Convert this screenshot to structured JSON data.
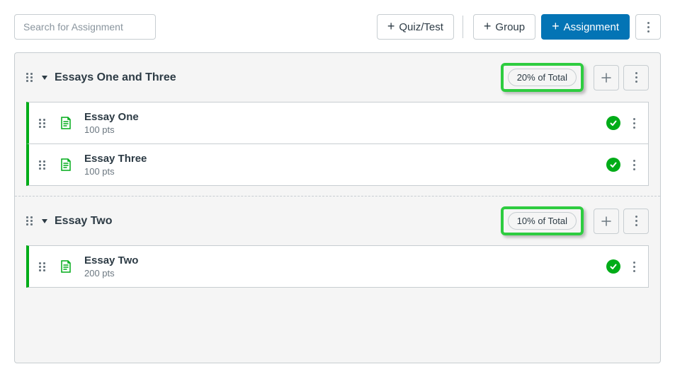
{
  "search": {
    "placeholder": "Search for Assignment"
  },
  "toolbar": {
    "quiz_label": "Quiz/Test",
    "group_label": "Group",
    "assignment_label": "Assignment"
  },
  "groups": [
    {
      "title": "Essays One and Three",
      "weight": "20% of Total",
      "items": [
        {
          "title": "Essay One",
          "pts": "100 pts"
        },
        {
          "title": "Essay Three",
          "pts": "100 pts"
        }
      ]
    },
    {
      "title": "Essay Two",
      "weight": "10% of Total",
      "items": [
        {
          "title": "Essay Two",
          "pts": "200 pts"
        }
      ]
    }
  ]
}
